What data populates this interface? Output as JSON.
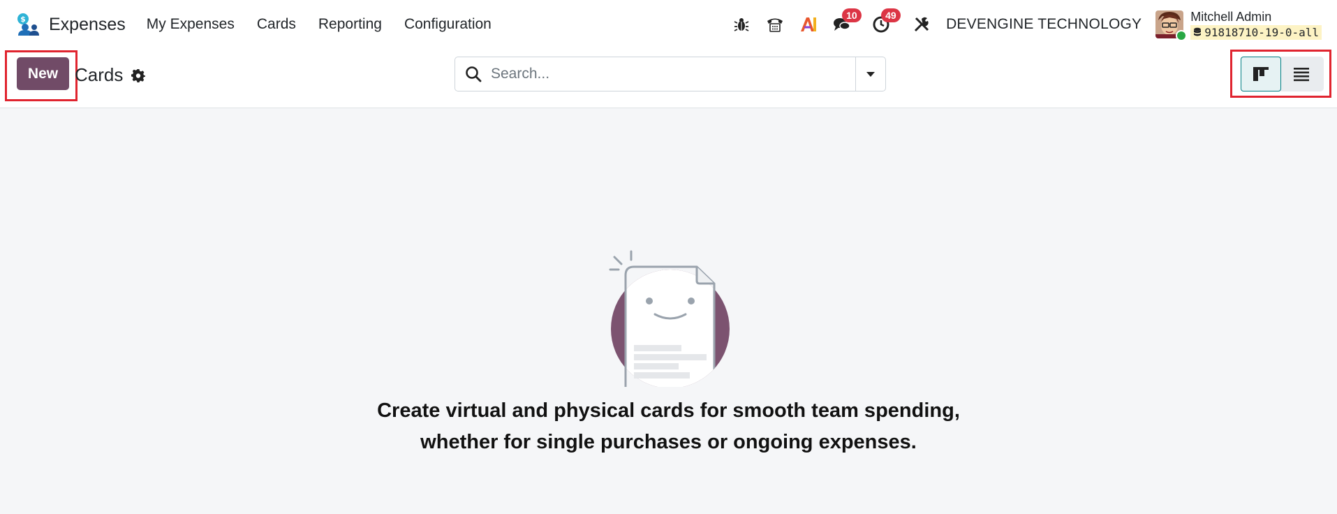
{
  "navbar": {
    "app_name": "Expenses",
    "menu": [
      {
        "label": "My Expenses"
      },
      {
        "label": "Cards"
      },
      {
        "label": "Reporting"
      },
      {
        "label": "Configuration"
      }
    ],
    "systray": {
      "messages_count": "10",
      "activities_count": "49",
      "ai_label": "AI",
      "company": "DEVENGINE TECHNOLOGY"
    },
    "user": {
      "name": "Mitchell Admin",
      "database": "91818710-19-0-all",
      "status": "online"
    }
  },
  "control_panel": {
    "new_label": "New",
    "breadcrumb_title": "Cards",
    "search_placeholder": "Search...",
    "active_view": "kanban",
    "views": [
      "kanban",
      "list"
    ]
  },
  "empty_state": {
    "line1": "Create virtual and physical cards for smooth team spending,",
    "line2": "whether for single purchases or ongoing expenses."
  },
  "colors": {
    "primary": "#714b67",
    "highlight": "#e0242f",
    "badge": "#dc3545",
    "active_view_border": "#017e84"
  }
}
